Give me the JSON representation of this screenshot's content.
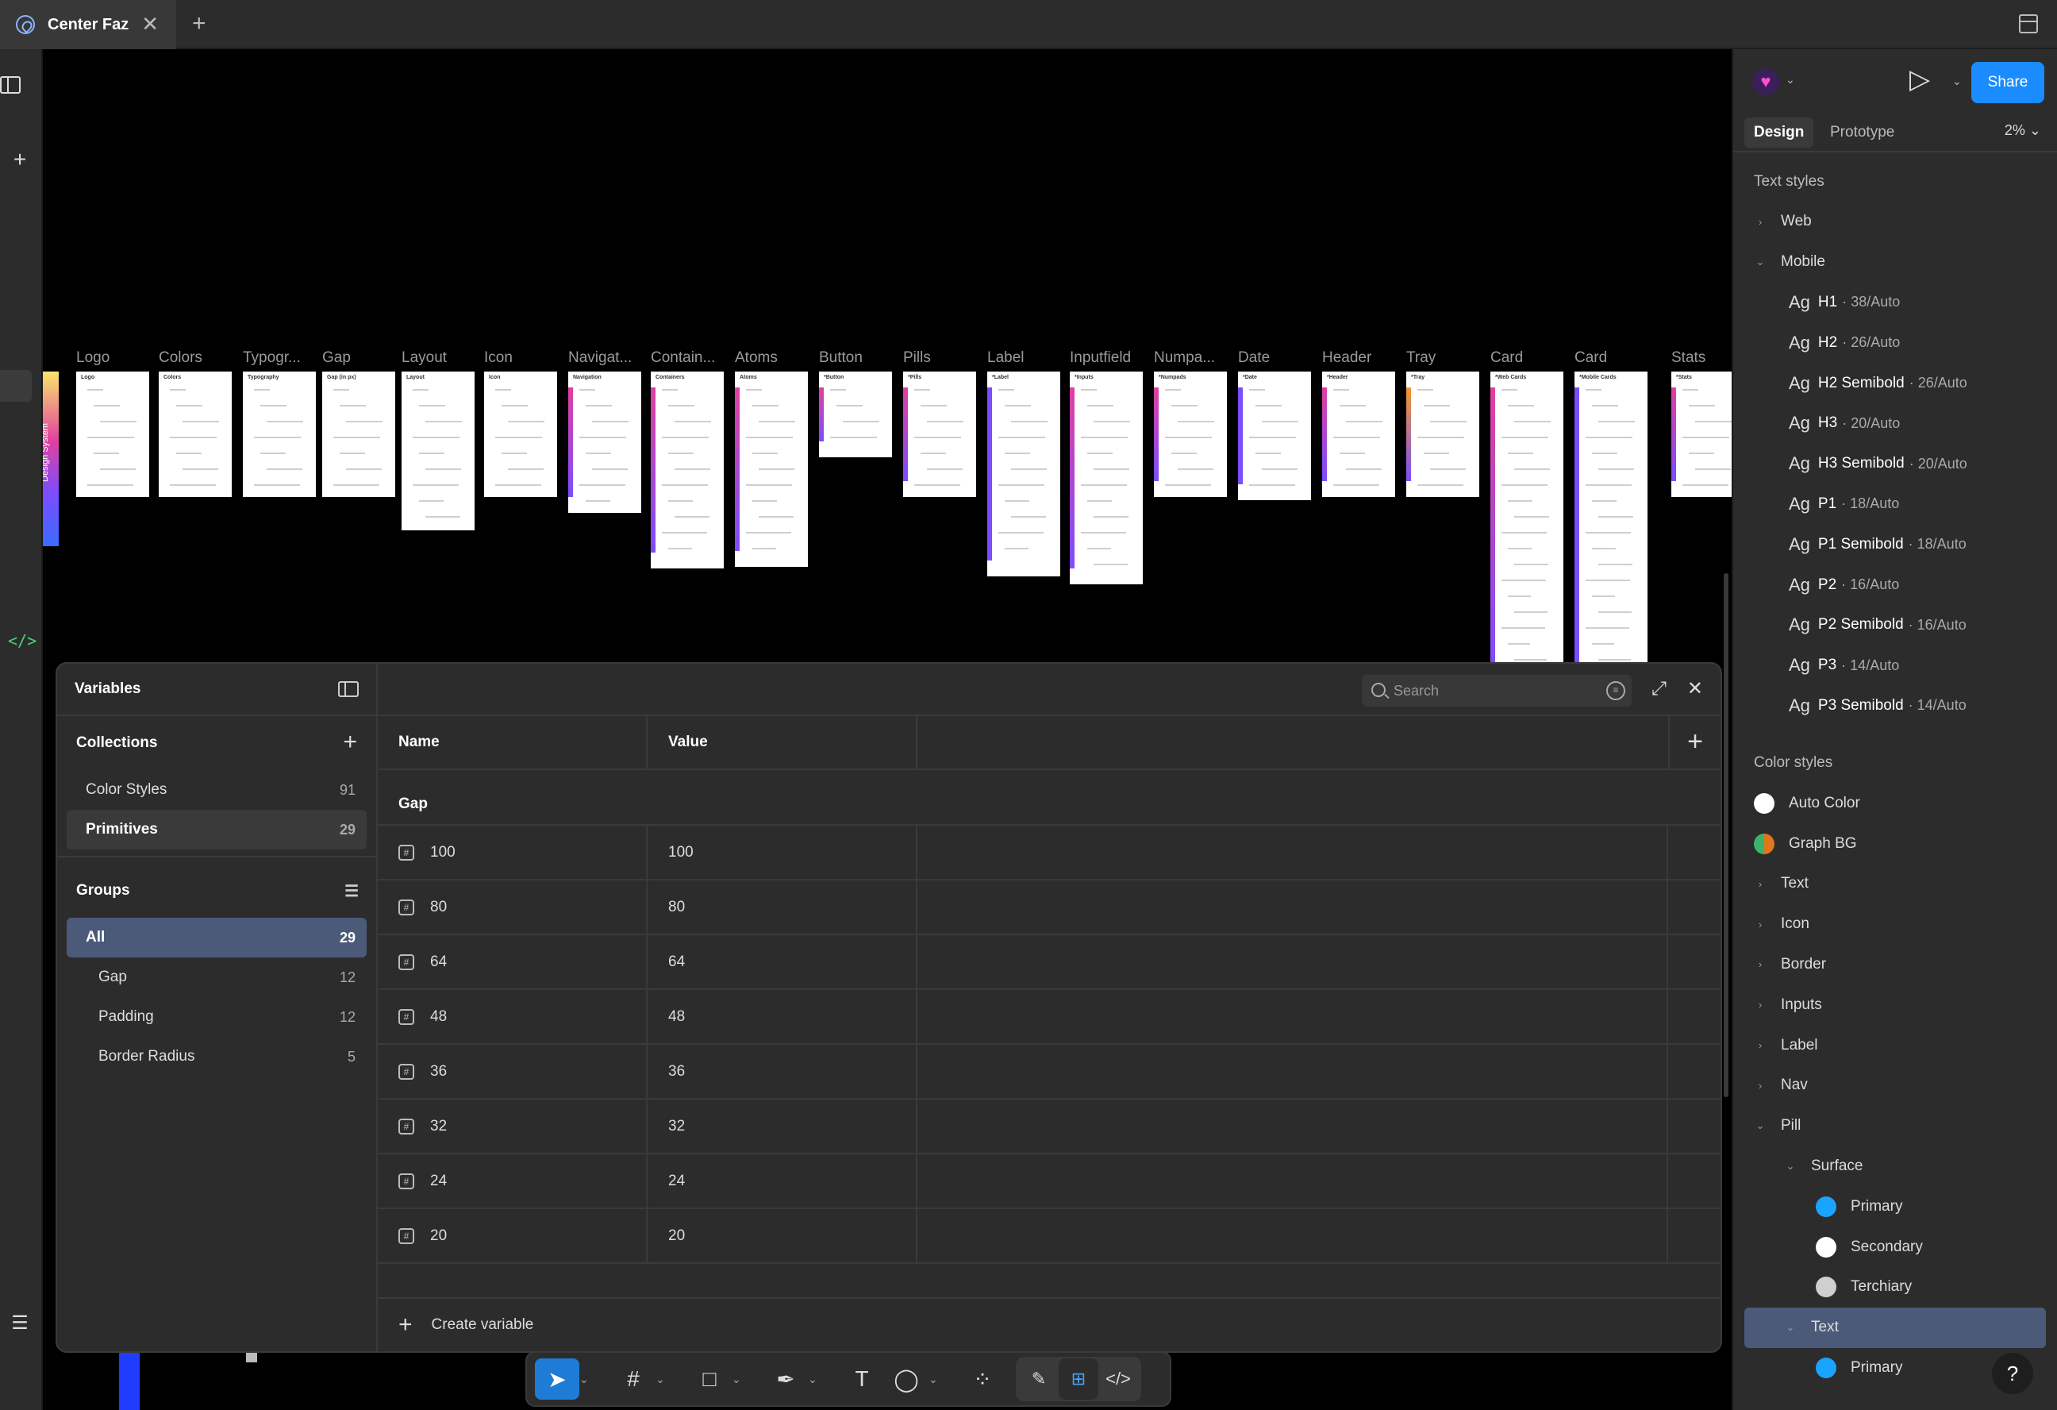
{
  "window": {
    "tab_title": "Center Faz"
  },
  "canvas": {
    "design_system_label": "Design System",
    "frames": [
      {
        "label": "Logo",
        "inner": "Logo"
      },
      {
        "label": "Colors",
        "inner": "Colors"
      },
      {
        "label": "Typogr...",
        "inner": "Typography"
      },
      {
        "label": "Gap",
        "inner": "Gap (in px)"
      },
      {
        "label": "Layout",
        "inner": "Layout"
      },
      {
        "label": "Icon",
        "inner": "Icon"
      },
      {
        "label": "Navigat...",
        "inner": "Navigation"
      },
      {
        "label": "Contain...",
        "inner": "Containers"
      },
      {
        "label": "Atoms",
        "inner": "Atoms"
      },
      {
        "label": "Button",
        "inner": "*Button"
      },
      {
        "label": "Pills",
        "inner": "*Pills"
      },
      {
        "label": "Label",
        "inner": "*Label"
      },
      {
        "label": "Inputfield",
        "inner": "*Inputs"
      },
      {
        "label": "Numpa...",
        "inner": "*Numpads"
      },
      {
        "label": "Date",
        "inner": "*Date"
      },
      {
        "label": "Header",
        "inner": "*Header"
      },
      {
        "label": "Tray",
        "inner": "*Tray"
      },
      {
        "label": "Card",
        "inner": "*Web Cards"
      },
      {
        "label": "Card",
        "inner": "*Mobile Cards"
      },
      {
        "label": "Stats",
        "inner": "*Stats"
      }
    ]
  },
  "variables": {
    "title": "Variables",
    "collections_label": "Collections",
    "collections": [
      {
        "name": "Color Styles",
        "count": "91"
      },
      {
        "name": "Primitives",
        "count": "29"
      }
    ],
    "groups_label": "Groups",
    "groups": [
      {
        "name": "All",
        "count": "29"
      },
      {
        "name": "Gap",
        "count": "12"
      },
      {
        "name": "Padding",
        "count": "12"
      },
      {
        "name": "Border Radius",
        "count": "5"
      }
    ],
    "search_placeholder": "Search",
    "columns": {
      "name": "Name",
      "value": "Value"
    },
    "group_heading": "Gap",
    "rows": [
      {
        "name": "100",
        "value": "100"
      },
      {
        "name": "80",
        "value": "80"
      },
      {
        "name": "64",
        "value": "64"
      },
      {
        "name": "48",
        "value": "48"
      },
      {
        "name": "36",
        "value": "36"
      },
      {
        "name": "32",
        "value": "32"
      },
      {
        "name": "24",
        "value": "24"
      },
      {
        "name": "20",
        "value": "20"
      }
    ],
    "create_label": "Create variable"
  },
  "right_panel": {
    "share_label": "Share",
    "tabs": {
      "design": "Design",
      "prototype": "Prototype"
    },
    "zoom": "2%",
    "text_styles_label": "Text styles",
    "text_groups": {
      "web": "Web",
      "mobile": "Mobile"
    },
    "text_styles": [
      {
        "name": "H1",
        "meta": "· 38/Auto"
      },
      {
        "name": "H2",
        "meta": "· 26/Auto"
      },
      {
        "name": "H2 Semibold",
        "meta": "· 26/Auto"
      },
      {
        "name": "H3",
        "meta": "· 20/Auto"
      },
      {
        "name": "H3 Semibold",
        "meta": "· 20/Auto"
      },
      {
        "name": "P1",
        "meta": "· 18/Auto"
      },
      {
        "name": "P1 Semibold",
        "meta": "· 18/Auto"
      },
      {
        "name": "P2",
        "meta": "· 16/Auto"
      },
      {
        "name": "P2 Semibold",
        "meta": "· 16/Auto"
      },
      {
        "name": "P3",
        "meta": "· 14/Auto"
      },
      {
        "name": "P3 Semibold",
        "meta": "· 14/Auto"
      }
    ],
    "ag_glyph": "Ag",
    "color_styles_label": "Color styles",
    "color_top": [
      {
        "name": "Auto Color",
        "color": "#ffffff"
      },
      {
        "name": "Graph BG",
        "color": "#e2761c"
      }
    ],
    "color_groups": [
      "Text",
      "Icon",
      "Border",
      "Inputs",
      "Label",
      "Nav"
    ],
    "pill": {
      "label": "Pill",
      "surface_label": "Surface",
      "surface": [
        {
          "name": "Primary",
          "color": "#1aa3ff"
        },
        {
          "name": "Secondary",
          "color": "#ffffff"
        },
        {
          "name": "Terchiary",
          "color": "#cfcfcf"
        }
      ],
      "text_label": "Text",
      "text": [
        {
          "name": "Primary",
          "color": "#1aa3ff"
        }
      ]
    },
    "help": "?"
  }
}
